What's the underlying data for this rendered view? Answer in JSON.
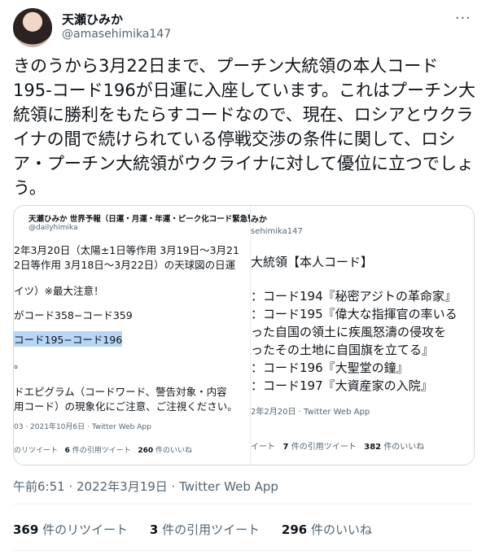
{
  "user": {
    "display_name": "天瀬ひみか",
    "handle": "@amasehimika147"
  },
  "menu_icon": "more-icon",
  "tweet": {
    "text": "きのうから3月22日まで、プーチン大統領の本人コード195-コード196が日運に入座しています。これはプーチン大統領に勝利をもたらすコードなので、現在、ロシアとウクライナの間で続けられている停戦交渉の条件に関して、ロシア・プーチン大統領がウクライナに対して優位に立つでしょう。"
  },
  "screenshot_left": {
    "name_line": "天瀬ひみか 世界予報（日運・月運・年運・ピーク化コード緊急警…",
    "handle": "@dailyhimika",
    "lines": [
      "2年3月20日（太陽±1日等作用 3月19日〜3月21",
      "2日等作用 3月18日〜3月22日）の天球図の日運",
      "イツ）※最大注意！",
      "がコード358−コード359",
      "コード195−コード196",
      "。",
      "ドエピグラム（コードワード、警告対象・内容",
      "用コード）の現象化にご注意、ご注視ください。"
    ],
    "timestamp": "03 · 2021年10月6日 · Twitter Web App",
    "stats": {
      "retweets_label": "のリツイート",
      "quotes": "6",
      "quotes_label": "件の引用ツイート",
      "likes": "260",
      "likes_label": "件のいいね"
    }
  },
  "screenshot_right": {
    "name_line": "みか",
    "handle": "sehimika147",
    "lines": [
      "大統領【本人コード】",
      "：コード194『秘密アジトの革命家』",
      "：コード195『偉大な指揮官の率いる",
      "った自国の領土に疾風怒濤の侵攻を",
      "ったその土地に自国旗を立てる』",
      "：コード196『大聖堂の鐘』",
      "：コード197『大資産家の入院』"
    ],
    "timestamp": "2年2月20日 · Twitter Web App",
    "stats": {
      "retweets_label": "イート",
      "quotes": "7",
      "quotes_label": "件の引用ツイート",
      "likes": "382",
      "likes_label": "件のいいね"
    }
  },
  "meta": {
    "timestamp": "午前6:51 · 2022年3月19日 · Twitter Web App"
  },
  "stats": {
    "retweets": "369",
    "retweets_label": "件のリツイート",
    "quotes": "3",
    "quotes_label": "件の引用ツイート",
    "likes": "296",
    "likes_label": "件のいいね"
  }
}
